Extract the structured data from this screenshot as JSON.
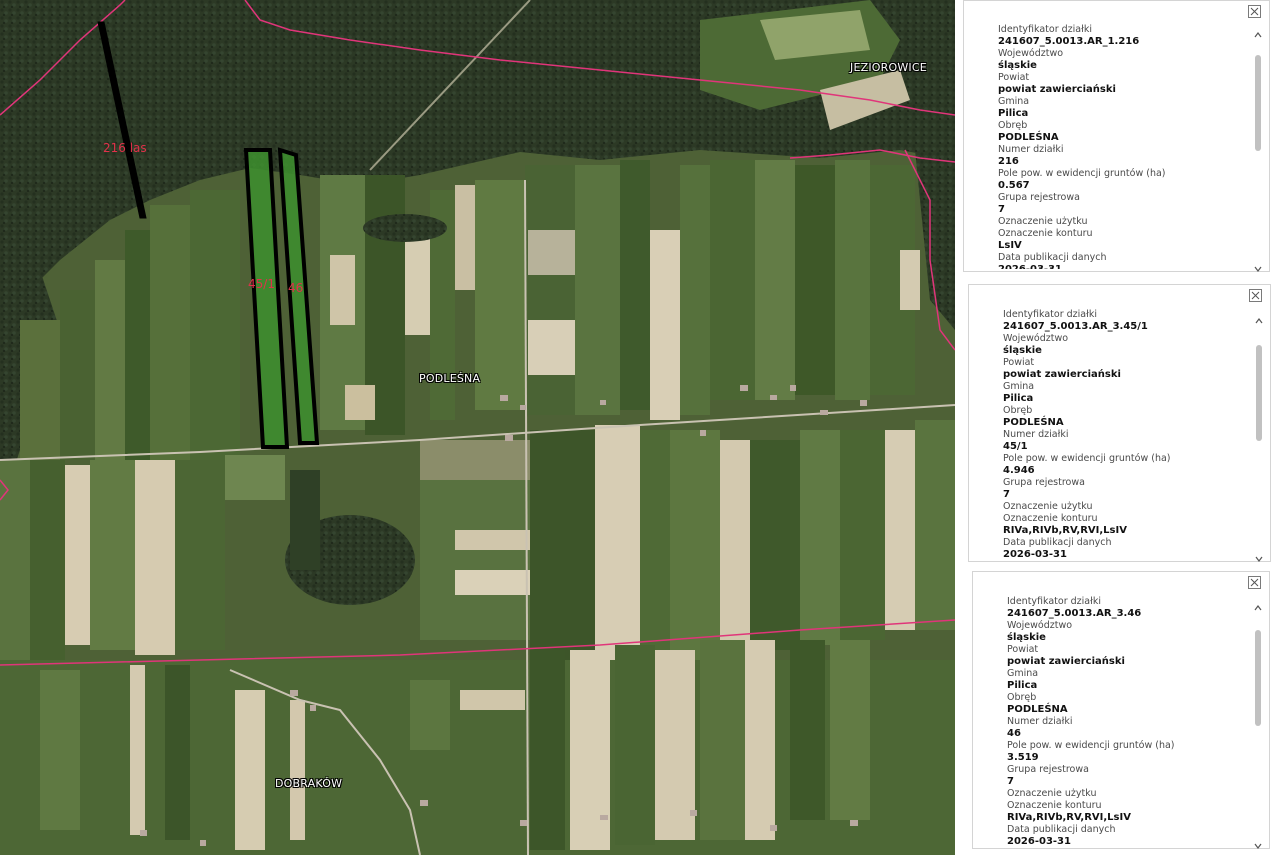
{
  "map": {
    "place_labels": [
      "JEZIOROWICE",
      "PODLEŚNA",
      "DOBRAKÓW"
    ],
    "parcel_labels": [
      "216 las",
      "45/1",
      "46"
    ],
    "colors": {
      "boundary": "#e0357a",
      "parcel_outline": "#000000",
      "parcel_fill": "#3d8f2e",
      "forest": "#2e3b26",
      "field_dark": "#3f5a2c",
      "field_light": "#d8ccb4"
    }
  },
  "panels": [
    {
      "fields": [
        {
          "label": "Identyfikator działki",
          "value": "241607_5.0013.AR_1.216"
        },
        {
          "label": "Województwo",
          "value": "śląskie"
        },
        {
          "label": "Powiat",
          "value": "powiat zawierciański"
        },
        {
          "label": "Gmina",
          "value": "Pilica"
        },
        {
          "label": "Obręb",
          "value": "PODLEŚNA"
        },
        {
          "label": "Numer działki",
          "value": "216"
        },
        {
          "label": "Pole pow. w ewidencji gruntów (ha)",
          "value": "0.567"
        },
        {
          "label": "Grupa rejestrowa",
          "value": "7"
        },
        {
          "label": "Oznaczenie użytku",
          "value": ""
        },
        {
          "label": "Oznaczenie konturu",
          "value": "LsIV"
        },
        {
          "label": "Data publikacji danych",
          "value": "2026-03-31"
        }
      ]
    },
    {
      "fields": [
        {
          "label": "Identyfikator działki",
          "value": "241607_5.0013.AR_3.45/1"
        },
        {
          "label": "Województwo",
          "value": "śląskie"
        },
        {
          "label": "Powiat",
          "value": "powiat zawierciański"
        },
        {
          "label": "Gmina",
          "value": "Pilica"
        },
        {
          "label": "Obręb",
          "value": "PODLEŚNA"
        },
        {
          "label": "Numer działki",
          "value": "45/1"
        },
        {
          "label": "Pole pow. w ewidencji gruntów (ha)",
          "value": "4.946"
        },
        {
          "label": "Grupa rejestrowa",
          "value": "7"
        },
        {
          "label": "Oznaczenie użytku",
          "value": ""
        },
        {
          "label": "Oznaczenie konturu",
          "value": "RIVa,RIVb,RV,RVI,LsIV"
        },
        {
          "label": "Data publikacji danych",
          "value": "2026-03-31"
        }
      ]
    },
    {
      "fields": [
        {
          "label": "Identyfikator działki",
          "value": "241607_5.0013.AR_3.46"
        },
        {
          "label": "Województwo",
          "value": "śląskie"
        },
        {
          "label": "Powiat",
          "value": "powiat zawierciański"
        },
        {
          "label": "Gmina",
          "value": "Pilica"
        },
        {
          "label": "Obręb",
          "value": "PODLEŚNA"
        },
        {
          "label": "Numer działki",
          "value": "46"
        },
        {
          "label": "Pole pow. w ewidencji gruntów (ha)",
          "value": "3.519"
        },
        {
          "label": "Grupa rejestrowa",
          "value": "7"
        },
        {
          "label": "Oznaczenie użytku",
          "value": ""
        },
        {
          "label": "Oznaczenie konturu",
          "value": "RIVa,RIVb,RV,RVI,LsIV"
        },
        {
          "label": "Data publikacji danych",
          "value": "2026-03-31"
        }
      ]
    }
  ]
}
